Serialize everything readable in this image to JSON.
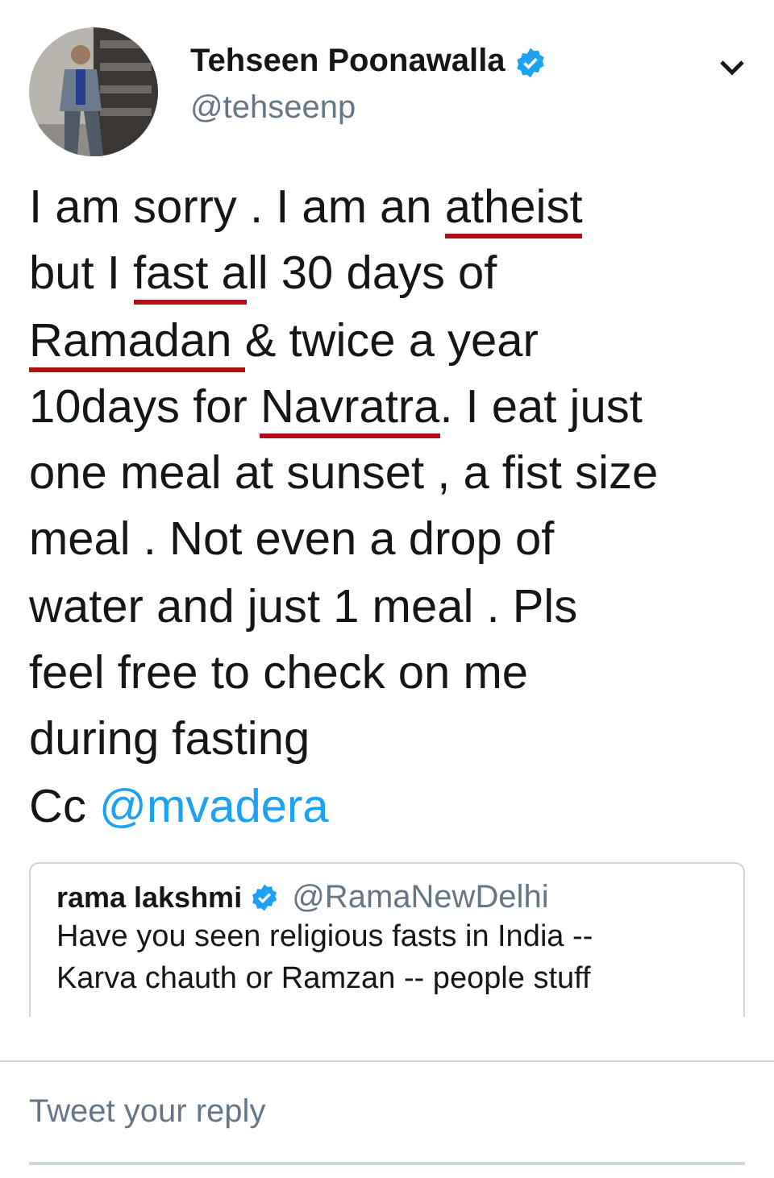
{
  "author": {
    "name": "Tehseen Poonawalla",
    "verified": true,
    "handle": "@tehseenp"
  },
  "tweet_lines": [
    [
      {
        "text": "I am sorry . I am an ",
        "underlined": false
      },
      {
        "text": "atheist",
        "underlined": true
      }
    ],
    [
      {
        "text": "but I ",
        "underlined": false
      },
      {
        "text": "fast a",
        "underlined": true
      },
      {
        "text": "ll 30 days of",
        "underlined": false
      }
    ],
    [
      {
        "text": "Ramadan ",
        "underlined": true
      },
      {
        "text": "& twice a year",
        "underlined": false
      }
    ],
    [
      {
        "text": "10days for ",
        "underlined": false
      },
      {
        "text": "Navratra",
        "underlined": true
      },
      {
        "text": ". I eat just",
        "underlined": false
      }
    ],
    [
      {
        "text": "one meal at sunset , a fist size",
        "underlined": false
      }
    ],
    [
      {
        "text": "meal . Not even a drop of",
        "underlined": false
      }
    ],
    [
      {
        "text": "water and just 1 meal . Pls",
        "underlined": false
      }
    ],
    [
      {
        "text": "feel free to check on me",
        "underlined": false
      }
    ],
    [
      {
        "text": "during fasting",
        "underlined": false
      }
    ],
    [
      {
        "text": " Cc ",
        "underlined": false,
        "kind": "text"
      },
      {
        "text": "@mvadera",
        "underlined": false,
        "kind": "mention"
      }
    ]
  ],
  "quoted_tweet": {
    "name": "rama lakshmi",
    "verified": true,
    "handle": "@RamaNewDelhi",
    "lines": [
      "Have you seen religious fasts in India --",
      "Karva chauth or Ramzan -- people stuff"
    ]
  },
  "reply_field": {
    "placeholder": "Tweet your reply"
  }
}
